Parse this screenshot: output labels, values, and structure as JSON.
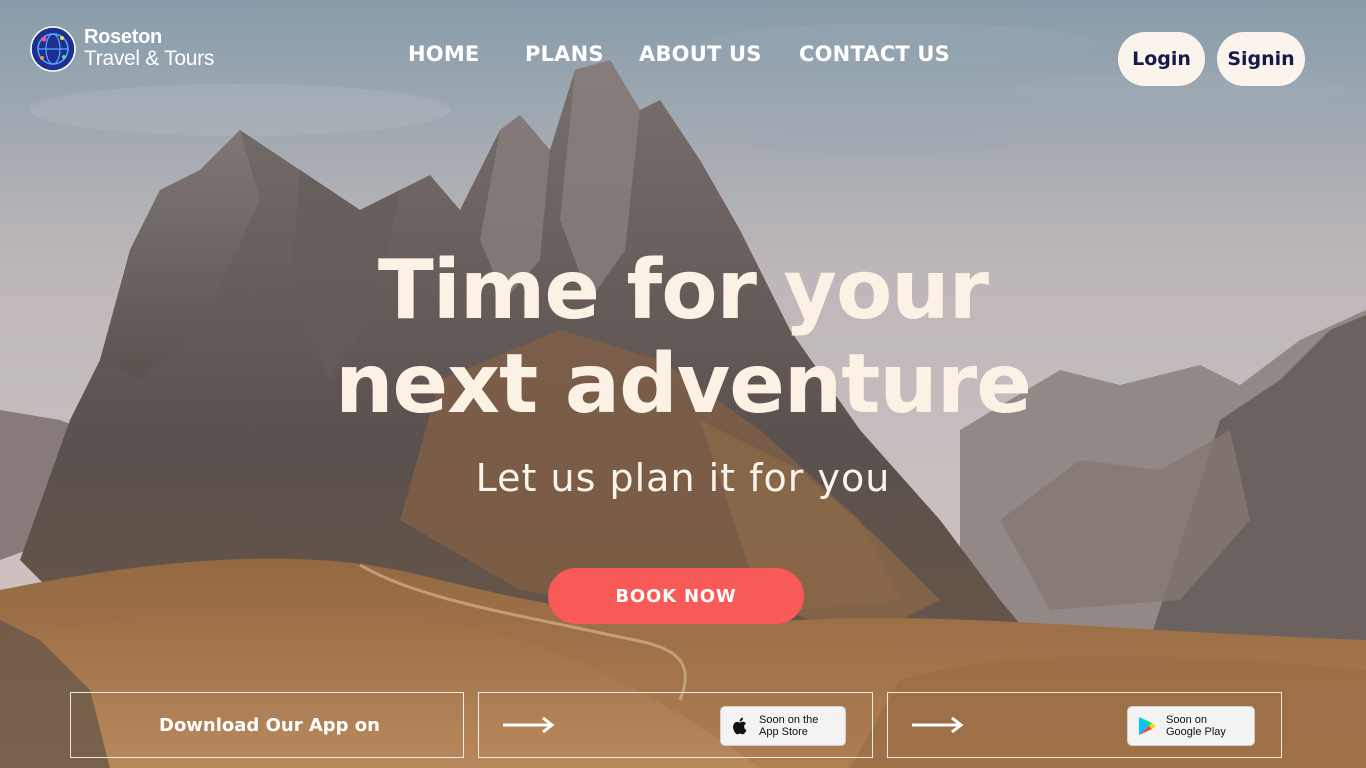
{
  "brand": {
    "name_line1": "Roseton",
    "name_line2": "Travel & Tours"
  },
  "nav": {
    "items": [
      {
        "label": "HOME"
      },
      {
        "label": "PLANS"
      },
      {
        "label": "ABOUT US"
      },
      {
        "label": "CONTACT US"
      }
    ]
  },
  "auth": {
    "login_label": "Login",
    "signin_label": "Signin"
  },
  "hero": {
    "title_line1": "Time for your",
    "title_line2": "next adventure",
    "subtitle": "Let us plan it for you",
    "cta_label": "BOOK NOW"
  },
  "app_download": {
    "label": "Download Our App on",
    "app_store": {
      "line1": "Soon on the",
      "line2": "App Store"
    },
    "google_play": {
      "line1": "Soon on",
      "line2": "Google Play"
    }
  },
  "colors": {
    "cta": "#f75a57",
    "auth_button_bg": "#fbf4ec",
    "auth_button_text": "#151a4c",
    "hero_text": "#fbf1e4"
  },
  "icons": {
    "logo": "globe-logo-icon",
    "arrows": "arrow-right-icon",
    "apple": "apple-icon",
    "google_play": "google-play-icon"
  }
}
